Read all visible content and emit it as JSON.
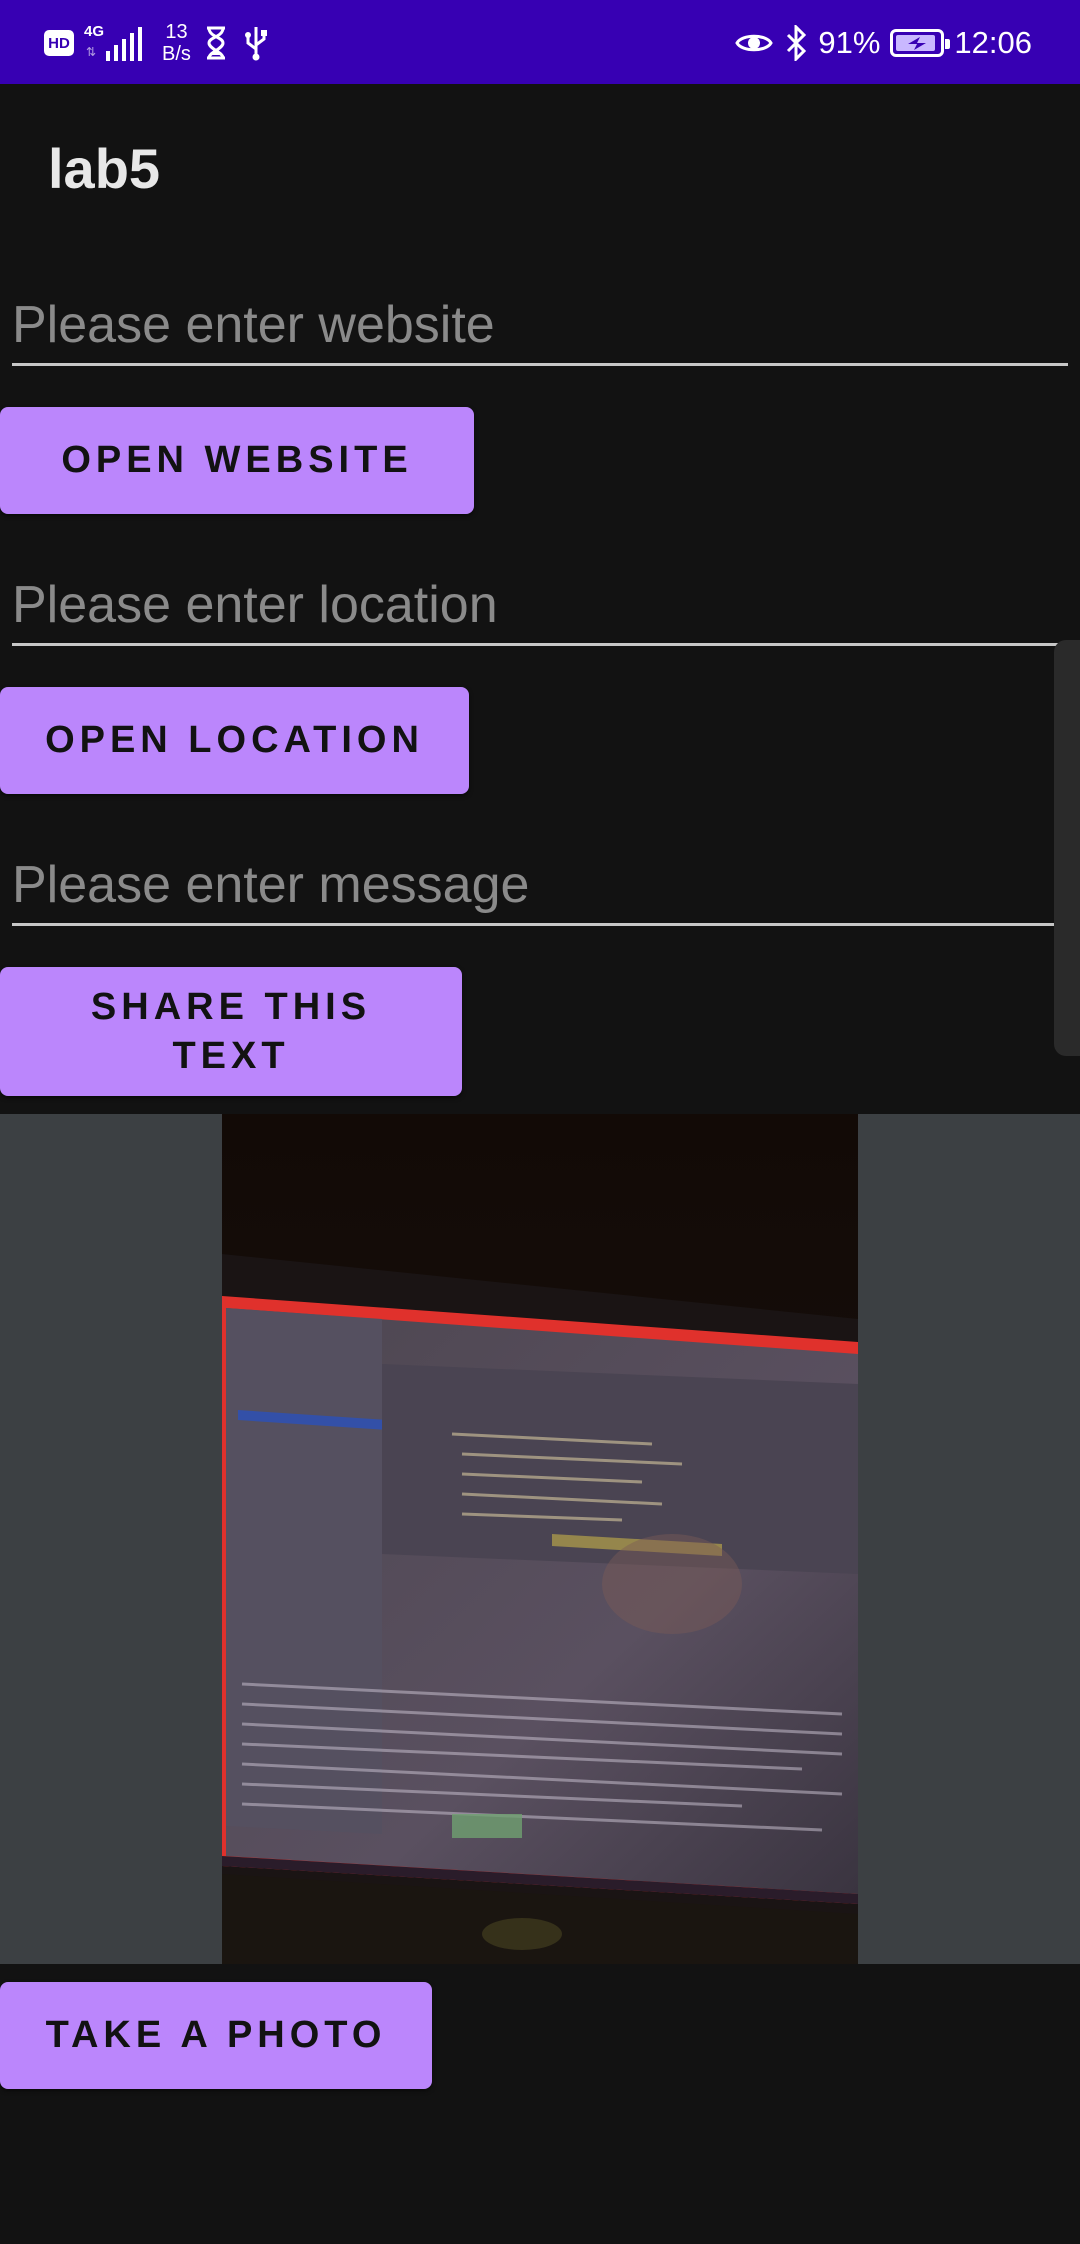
{
  "status_bar": {
    "hd": "HD",
    "network": "4G",
    "net_speed_value": "13",
    "net_speed_unit": "B/s",
    "battery": "91%",
    "time": "12:06",
    "icons": [
      "hd-icon",
      "signal-icon",
      "hourglass-icon",
      "usb-icon",
      "eye-icon",
      "bluetooth-icon",
      "battery-charging-icon"
    ]
  },
  "app": {
    "title": "lab5"
  },
  "website": {
    "placeholder": "Please enter website",
    "value": "",
    "button": "OPEN WEBSITE"
  },
  "location": {
    "placeholder": "Please enter location",
    "value": "",
    "button": "OPEN LOCATION"
  },
  "message": {
    "placeholder": "Please enter message",
    "value": "",
    "button_line1": "SHARE THIS",
    "button_line2": "TEXT"
  },
  "photo": {
    "button": "TAKE A PHOTO"
  },
  "colors": {
    "status_bar": "#3700b3",
    "accent": "#bb86fc",
    "background": "#121212",
    "photo_bg": "#3c4043"
  }
}
